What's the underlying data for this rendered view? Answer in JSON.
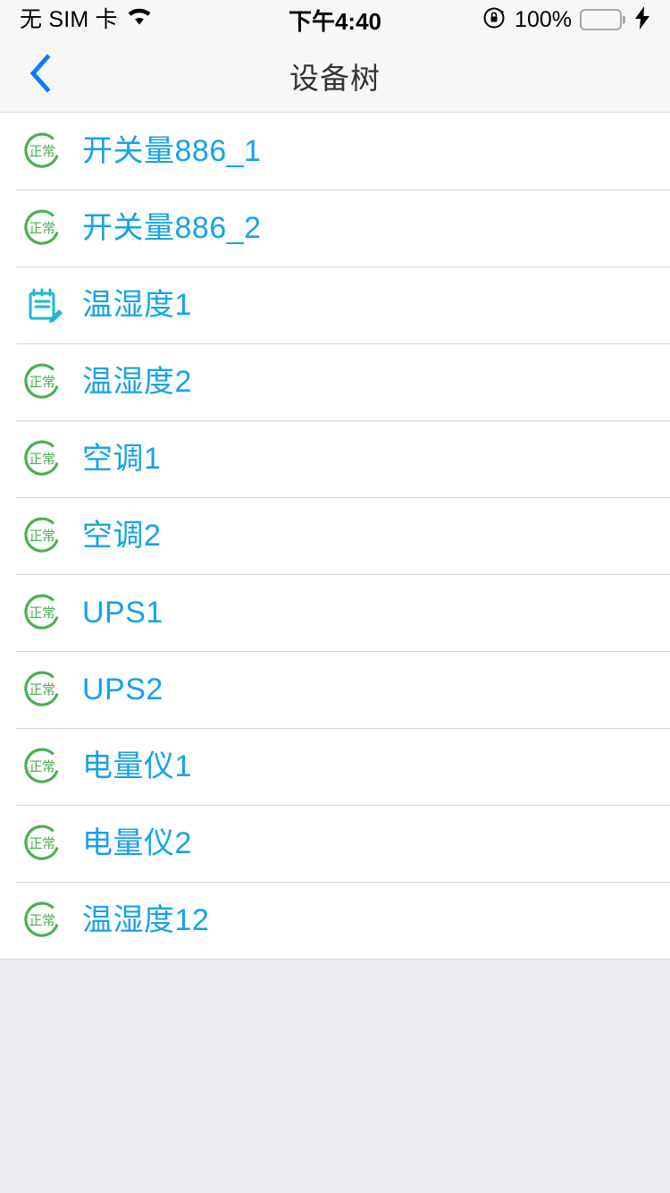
{
  "status_bar": {
    "carrier": "无 SIM 卡",
    "wifi_icon": "wifi-icon",
    "time": "下午4:40",
    "rotation_lock_icon": "rotation-lock-icon",
    "battery_percent": "100%",
    "battery_icon": "battery-full-icon",
    "charging_icon": "lightning-bolt-icon",
    "battery_color": "#4cd964"
  },
  "nav": {
    "back_icon": "chevron-left-icon",
    "title": "设备树",
    "accent_color": "#0a7cff"
  },
  "colors": {
    "label_blue": "#17a2e8",
    "status_green": "#4caf50",
    "note_cyan": "#1bb8d4",
    "page_background": "#eeeef2",
    "list_background": "#ffffff",
    "separator": "#d2d2d2"
  },
  "list": {
    "items": [
      {
        "label": "开关量886_1",
        "icon": "status-normal-ring-icon",
        "status_text": "正常"
      },
      {
        "label": "开关量886_2",
        "icon": "status-normal-ring-icon",
        "status_text": "正常"
      },
      {
        "label": "温湿度1",
        "icon": "note-edit-icon",
        "status_text": ""
      },
      {
        "label": "温湿度2",
        "icon": "status-normal-ring-icon",
        "status_text": "正常"
      },
      {
        "label": "空调1",
        "icon": "status-normal-ring-icon",
        "status_text": "正常"
      },
      {
        "label": "空调2",
        "icon": "status-normal-ring-icon",
        "status_text": "正常"
      },
      {
        "label": "UPS1",
        "icon": "status-normal-ring-icon",
        "status_text": "正常"
      },
      {
        "label": "UPS2",
        "icon": "status-normal-ring-icon",
        "status_text": "正常"
      },
      {
        "label": "电量仪1",
        "icon": "status-normal-ring-icon",
        "status_text": "正常"
      },
      {
        "label": "电量仪2",
        "icon": "status-normal-ring-icon",
        "status_text": "正常"
      },
      {
        "label": "温湿度12",
        "icon": "status-normal-ring-icon",
        "status_text": "正常"
      }
    ]
  }
}
